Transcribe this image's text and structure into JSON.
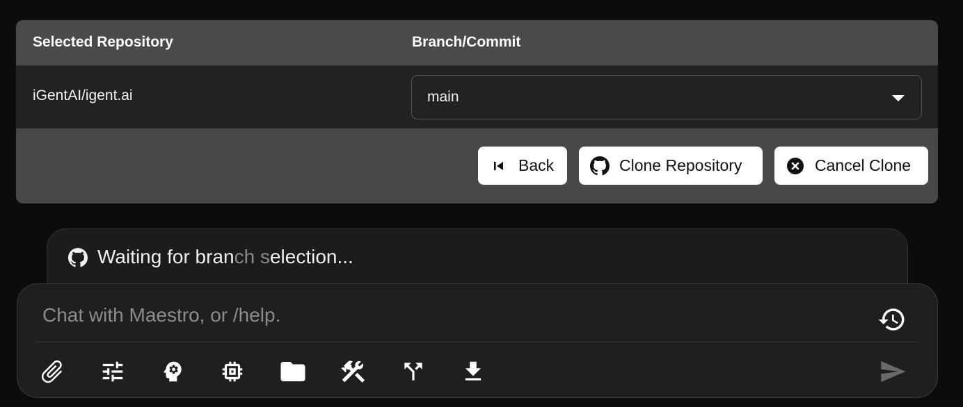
{
  "repo_table": {
    "headers": [
      "Selected Repository",
      "Branch/Commit"
    ],
    "repository": "iGentAI/igent.ai",
    "branch_value": "main"
  },
  "actions": {
    "back_label": "Back",
    "clone_label": "Clone Repository",
    "cancel_label": "Cancel Clone"
  },
  "status": {
    "text_a": "Waiting for bran",
    "text_dim": "ch s",
    "text_b": "election..."
  },
  "chat": {
    "placeholder": "Chat with Maestro, or /help.",
    "value": ""
  },
  "toolbar_icons": [
    "paperclip-icon",
    "sliders-icon",
    "brain-gear-icon",
    "chip-icon",
    "folder-icon",
    "tools-icon",
    "fork-icon",
    "download-icon"
  ],
  "colors": {
    "panel": "#474747",
    "row": "#222222",
    "button": "#ffffff",
    "page": "#0c0c0c"
  }
}
